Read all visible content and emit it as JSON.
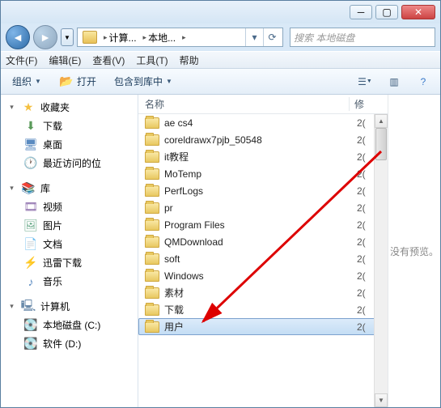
{
  "breadcrumb": {
    "seg1": "计算...",
    "seg2": "本地...",
    "refresh_hint": "⟳"
  },
  "search": {
    "placeholder": "搜索 本地磁盘"
  },
  "menubar": {
    "file": "文件(F)",
    "edit": "编辑(E)",
    "view": "查看(V)",
    "tools": "工具(T)",
    "help": "帮助"
  },
  "toolbar": {
    "organize": "组织",
    "open": "打开",
    "include": "包含到库中"
  },
  "nav": {
    "fav": "收藏夹",
    "fav_items": {
      "downloads": "下载",
      "desktop": "桌面",
      "recent": "最近访问的位"
    },
    "libs": "库",
    "libs_items": {
      "video": "视频",
      "pic": "图片",
      "doc": "文档",
      "thunder": "迅雷下载",
      "music": "音乐"
    },
    "comp": "计算机",
    "comp_items": {
      "c": "本地磁盘 (C:)",
      "d": "软件 (D:)"
    }
  },
  "listhead": {
    "name": "名称",
    "mod": "修"
  },
  "files": [
    {
      "name": "ae cs4",
      "mod": "2("
    },
    {
      "name": "coreldrawx7pjb_50548",
      "mod": "2("
    },
    {
      "name": "it教程",
      "mod": "2("
    },
    {
      "name": "MoTemp",
      "mod": "2("
    },
    {
      "name": "PerfLogs",
      "mod": "2("
    },
    {
      "name": "pr",
      "mod": "2("
    },
    {
      "name": "Program Files",
      "mod": "2("
    },
    {
      "name": "QMDownload",
      "mod": "2("
    },
    {
      "name": "soft",
      "mod": "2("
    },
    {
      "name": "Windows",
      "mod": "2("
    },
    {
      "name": "素材",
      "mod": "2("
    },
    {
      "name": "下载",
      "mod": "2("
    },
    {
      "name": "用户",
      "mod": "2("
    }
  ],
  "preview": {
    "text": "没有预览。"
  },
  "selected_index": 12
}
